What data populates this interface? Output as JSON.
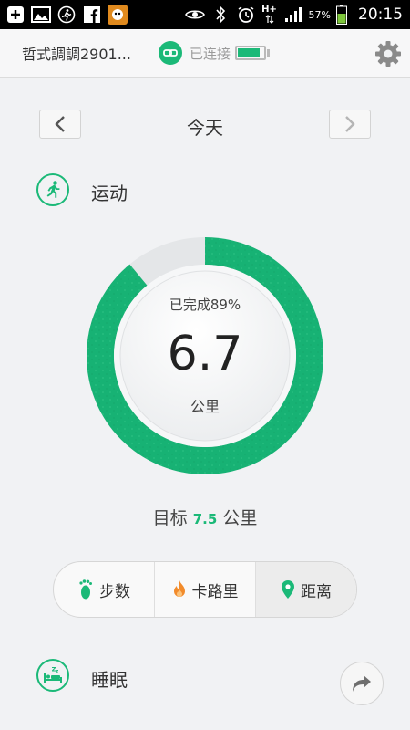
{
  "status_bar": {
    "left_icons": [
      "plus-icon",
      "image-icon",
      "runner-icon",
      "facebook-icon",
      "app-icon"
    ],
    "right_icons": [
      "eye-icon",
      "bluetooth-icon",
      "alarm-icon",
      "hplus-icon",
      "signal-icon",
      "battery-icon"
    ],
    "network": "H+",
    "battery_percent": "57%",
    "time": "20:15"
  },
  "header": {
    "device_name": "哲式調調2901...",
    "connection_status": "已连接",
    "device_battery_level": 0.85
  },
  "date_nav": {
    "title": "今天"
  },
  "activity": {
    "title": "运动",
    "completed_label": "已完成89%",
    "value": "6.7",
    "unit": "公里",
    "progress": 0.89,
    "goal_prefix": "目标",
    "goal_value": "7.5",
    "goal_unit": "公里"
  },
  "tabs": [
    {
      "label": "步数",
      "icon": "footprint-icon"
    },
    {
      "label": "卡路里",
      "icon": "flame-icon"
    },
    {
      "label": "距离",
      "icon": "location-pin-icon"
    }
  ],
  "sleep": {
    "title": "睡眠"
  },
  "colors": {
    "accent": "#1bb978",
    "ring_track": "#e4e6e8",
    "flame": "#f28b2b"
  }
}
